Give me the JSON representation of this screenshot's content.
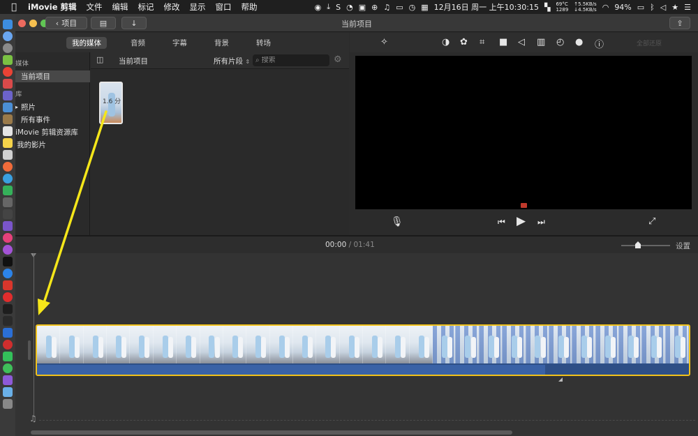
{
  "menubar": {
    "apple": "",
    "app_name": "iMovie 剪辑",
    "items": [
      "文件",
      "编辑",
      "标记",
      "修改",
      "显示",
      "窗口",
      "帮助"
    ],
    "status": {
      "temp": "69°C",
      "fan": "1289",
      "net_up": "↑5.5KB/s",
      "net_down": "↓4.5KB/s",
      "datetime": "12月16日 周一 上午10:30:15",
      "battery": "94%"
    }
  },
  "window": {
    "title": "当前项目",
    "back_button": "项目"
  },
  "media_tabs": [
    "我的媒体",
    "音频",
    "字幕",
    "背景",
    "转场"
  ],
  "sidebar": {
    "section_media": "媒体",
    "current_project": "当前项目",
    "section_library": "库",
    "photos": "照片",
    "all_events": "所有事件",
    "library_name": "iMovie 剪辑资源库",
    "my_movies": "我的影片"
  },
  "browser": {
    "title": "当前项目",
    "filter": "所有片段",
    "search_placeholder": "搜索",
    "clip_duration": "1.6 分"
  },
  "viewer": {
    "reset_all": "全部还原"
  },
  "timeline": {
    "current_time": "00:00",
    "separator": "/",
    "total_time": "01:41",
    "settings": "设置"
  },
  "colors": {
    "clip_border": "#f1c21b",
    "audio": "#3a62a6",
    "arrow": "#f5e61a"
  }
}
